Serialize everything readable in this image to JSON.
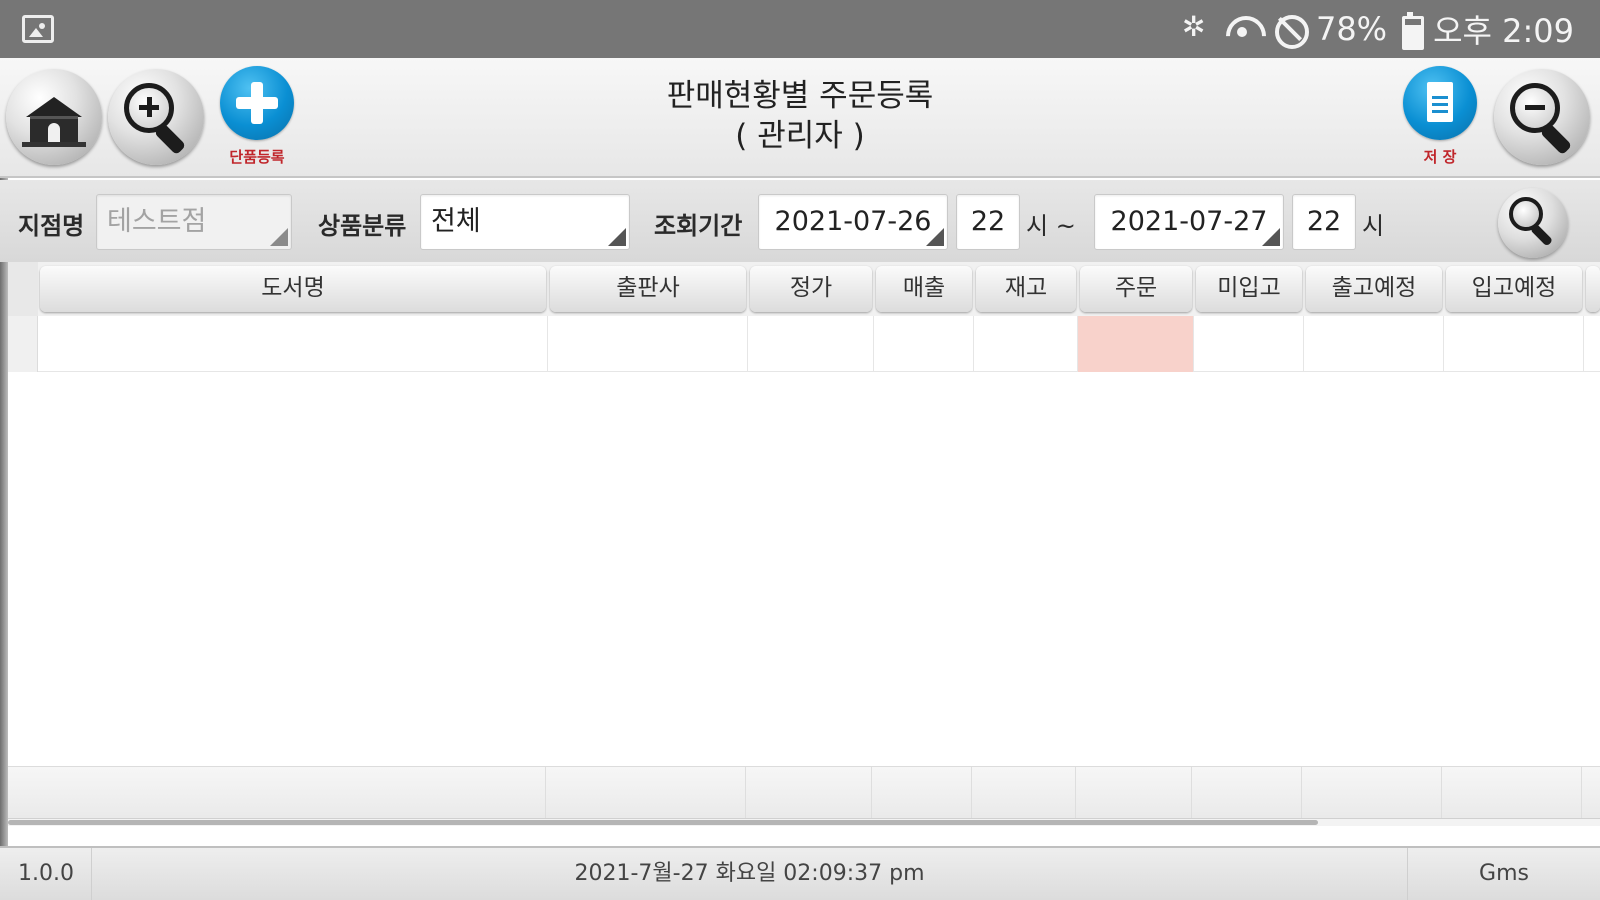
{
  "statusbar": {
    "battery": "78%",
    "time": "오후 2:09",
    "icons": [
      "image-icon",
      "bluetooth-icon",
      "wifi-icon",
      "do-not-disturb-icon",
      "battery-icon"
    ]
  },
  "toolbar": {
    "title_line1": "판매현황별 주문등록",
    "title_line2": "( 관리자 )",
    "add_label": "단품등록",
    "save_label": "저 장",
    "icons": [
      "home-icon",
      "zoom-in-icon",
      "plus-icon",
      "document-icon",
      "zoom-out-icon"
    ]
  },
  "filters": {
    "branch_label": "지점명",
    "branch_value": "테스트점",
    "category_label": "상품분류",
    "category_value": "전체",
    "period_label": "조회기간",
    "start_date": "2021-07-26",
    "start_hour": "22",
    "start_hour_suffix": "시 ~",
    "end_date": "2021-07-27",
    "end_hour": "22",
    "end_hour_suffix": "시"
  },
  "grid": {
    "columns": [
      "도서명",
      "출판사",
      "정가",
      "매출",
      "재고",
      "주문",
      "미입고",
      "출고예정",
      "입고예정"
    ],
    "rows": [
      [
        "",
        "",
        "",
        "",
        "",
        "",
        "",
        "",
        ""
      ]
    ]
  },
  "footer": {
    "version": "1.0.0",
    "datetime": "2021-7월-27 화요일 02:09:37 pm",
    "user": "Gms"
  },
  "colors": {
    "statusbar_bg": "#767676",
    "accent_blue": "#0a8fd3",
    "label_red": "#c0262b",
    "order_cell_bg": "#f8d2cb"
  }
}
